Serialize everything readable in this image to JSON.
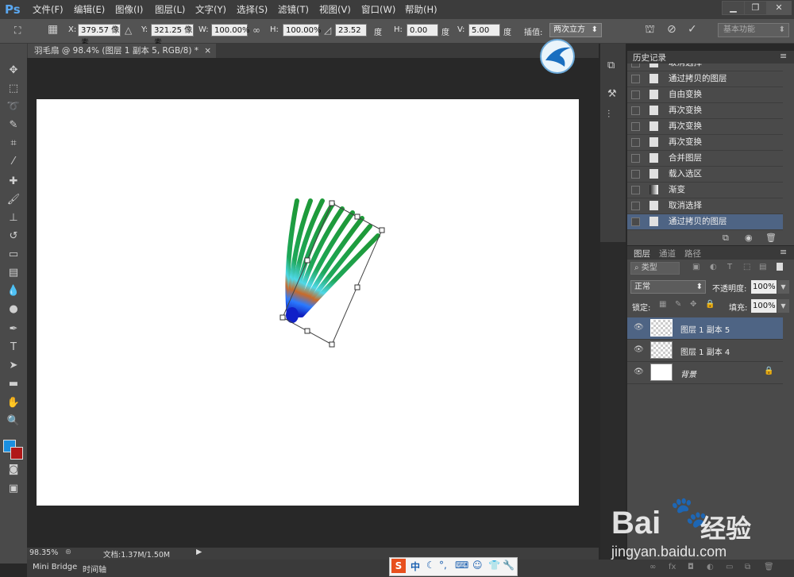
{
  "app": {
    "logo": "Ps"
  },
  "menu": [
    "文件(F)",
    "编辑(E)",
    "图像(I)",
    "图层(L)",
    "文字(Y)",
    "选择(S)",
    "滤镜(T)",
    "视图(V)",
    "窗口(W)",
    "帮助(H)"
  ],
  "window_controls": {
    "minimize": "▁",
    "restore": "❐",
    "close": "✕"
  },
  "options": {
    "x_label": "X:",
    "x_value": "379.57 像素",
    "y_label": "Y:",
    "y_value": "321.25 像素",
    "w_label": "W:",
    "w_value": "100.00%",
    "h_label": "H:",
    "h_value": "100.00%",
    "angle_value": "23.52",
    "angle_unit": "度",
    "hskew_label": "H:",
    "hskew_value": "0.00",
    "hskew_unit": "度",
    "vskew_label": "V:",
    "vskew_value": "5.00",
    "vskew_unit": "度",
    "interp_label": "插值:",
    "interp_value": "两次立方",
    "workspace": "基本功能"
  },
  "document": {
    "tab_title": "羽毛扇 @ 98.4% (图层 1 副本 5, RGB/8) *",
    "tab_close": "×"
  },
  "status": {
    "zoom": "98.35%",
    "doc_info": "文档:1.37M/1.50M"
  },
  "bottom_tabs": [
    "Mini Bridge",
    "时间轴"
  ],
  "history": {
    "title": "历史记录",
    "items": [
      {
        "label": "取消选择",
        "type": "doc"
      },
      {
        "label": "通过拷贝的图层",
        "type": "doc"
      },
      {
        "label": "自由变换",
        "type": "doc"
      },
      {
        "label": "再次变换",
        "type": "doc"
      },
      {
        "label": "再次变换",
        "type": "doc"
      },
      {
        "label": "再次变换",
        "type": "doc"
      },
      {
        "label": "合并图层",
        "type": "doc"
      },
      {
        "label": "载入选区",
        "type": "doc"
      },
      {
        "label": "渐变",
        "type": "gradient"
      },
      {
        "label": "取消选择",
        "type": "doc"
      },
      {
        "label": "通过拷贝的图层",
        "type": "doc",
        "selected": true
      }
    ]
  },
  "layers": {
    "tabs": [
      "图层",
      "通道",
      "路径"
    ],
    "filter_kind": "类型",
    "blend_mode": "正常",
    "opacity_label": "不透明度:",
    "opacity_value": "100%",
    "lock_label": "锁定:",
    "fill_label": "填充:",
    "fill_value": "100%",
    "items": [
      {
        "name": "图层 1 副本 5",
        "selected": true
      },
      {
        "name": "图层 1 副本 4",
        "selected": false
      },
      {
        "name": "背景",
        "selected": false,
        "locked": true
      }
    ]
  },
  "ime": {
    "label": "中"
  },
  "watermark": {
    "brand_a": "Bai",
    "brand_b": "经验",
    "url": "jingyan.baidu.com"
  },
  "colors": {
    "foreground": "#1a8fe0",
    "background": "#b01818",
    "accent": "#4e6484"
  }
}
